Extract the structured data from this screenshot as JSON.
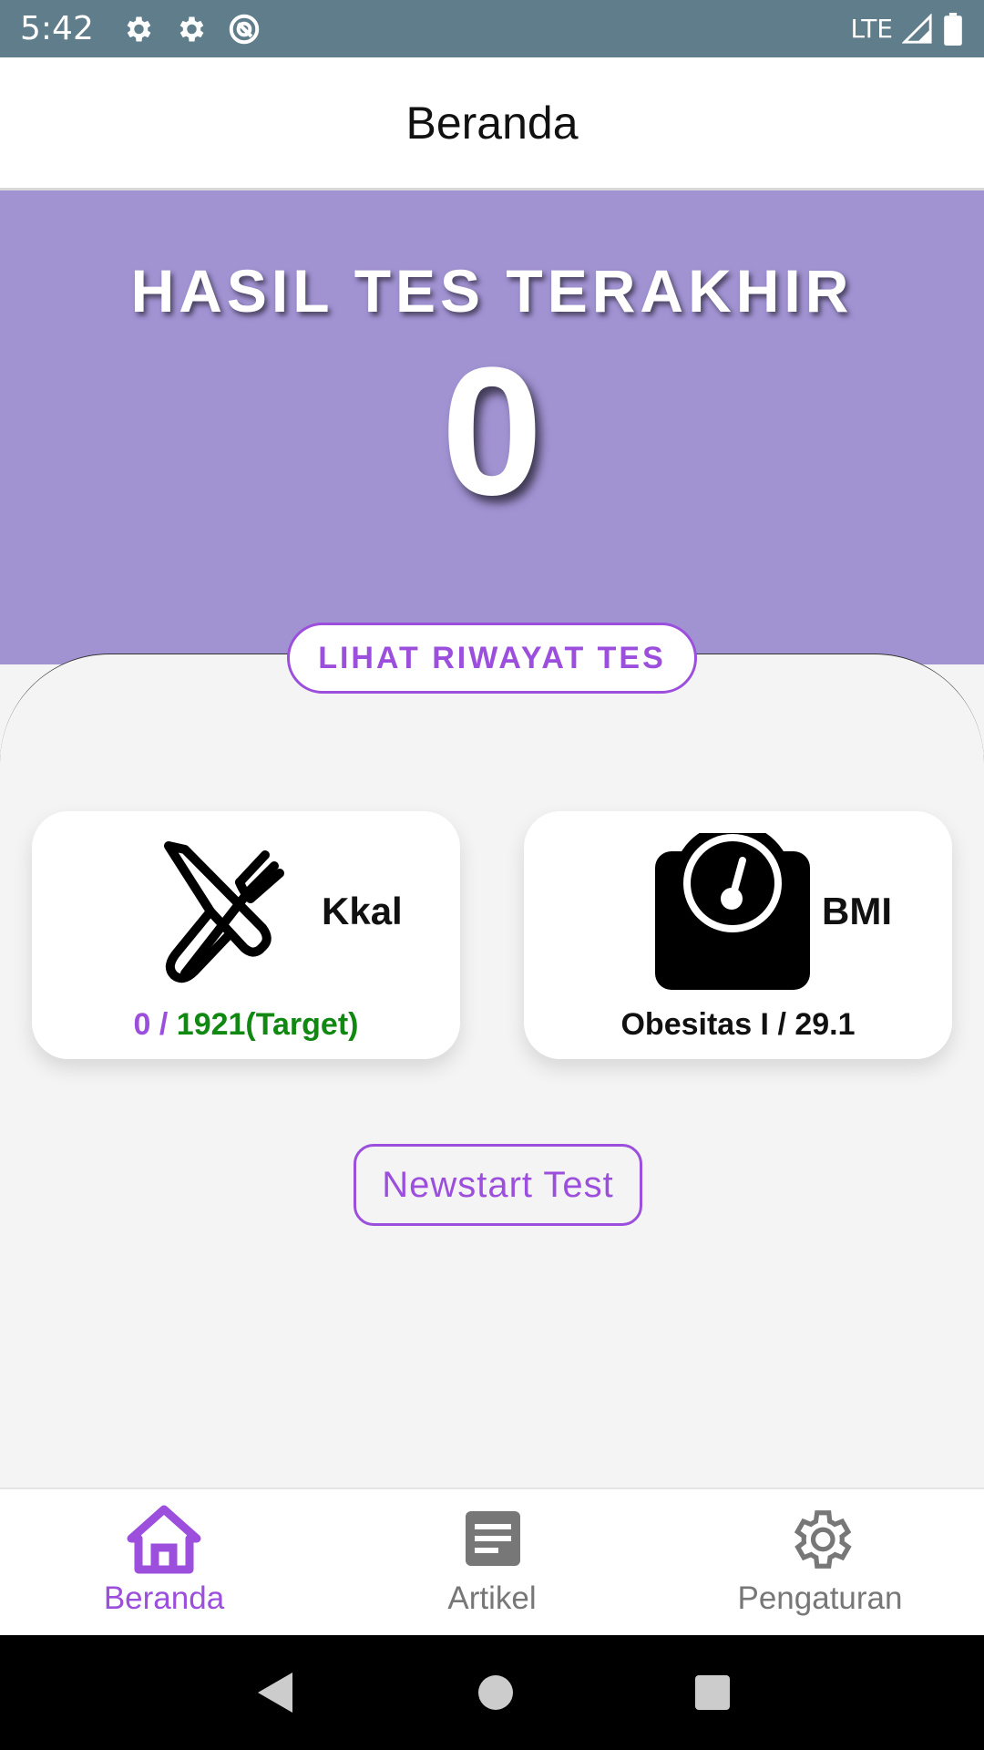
{
  "status_bar": {
    "time": "5:42",
    "network": "LTE",
    "icons": [
      "settings-icon",
      "settings-icon",
      "data-saver-icon",
      "signal-icon",
      "battery-icon"
    ]
  },
  "app_bar": {
    "title": "Beranda"
  },
  "hero": {
    "title": "HASIL TES TERAKHIR",
    "score": "0",
    "background_color": "#a192d2"
  },
  "history_button": {
    "label": "LIHAT RIWAYAT TES"
  },
  "cards": {
    "kcal": {
      "icon": "utensils-icon",
      "label": "Kkal",
      "current": "0",
      "separator": " / ",
      "target": "1921(Target)"
    },
    "bmi": {
      "icon": "scale-icon",
      "label": "BMI",
      "value": "Obesitas I / 29.1"
    }
  },
  "newstart_button": {
    "label": "Newstart Test"
  },
  "bottom_nav": {
    "items": [
      {
        "label": "Beranda",
        "icon": "home-icon",
        "active": true
      },
      {
        "label": "Artikel",
        "icon": "article-icon",
        "active": false
      },
      {
        "label": "Pengaturan",
        "icon": "gear-icon",
        "active": false
      }
    ]
  },
  "colors": {
    "accent": "#9b4fdc",
    "status_bar": "#607d8b",
    "target_green": "#118811"
  }
}
